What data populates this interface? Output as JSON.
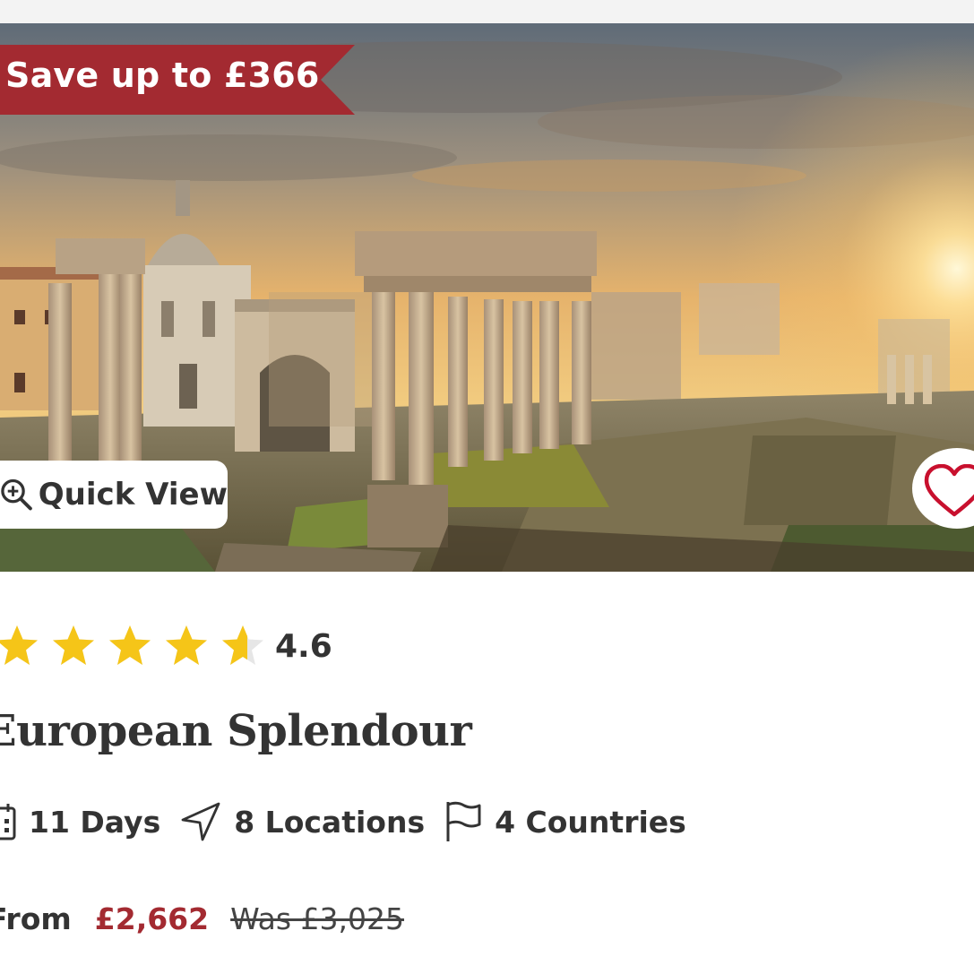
{
  "card": {
    "badge": {
      "label": "Save up to £366",
      "color": "#a32a31"
    },
    "image": {
      "subject": "Roman Forum ruins at sunset"
    },
    "quick_view": {
      "label": "Quick View",
      "icon": "zoom-in-icon"
    },
    "favorite": {
      "icon": "heart-outline-icon",
      "color": "#c8102e"
    },
    "rating": {
      "value": "4.6",
      "stars_filled": 4.6,
      "stars_total": 5,
      "star_color": "#f5c518"
    },
    "title": "European Splendour",
    "meta": {
      "days": {
        "label": "11 Days",
        "icon": "calendar-icon"
      },
      "locations": {
        "label": "8 Locations",
        "icon": "navigation-arrow-icon"
      },
      "countries": {
        "label": "4 Countries",
        "icon": "flag-icon"
      }
    },
    "price": {
      "from_label": "From",
      "current": "£2,662",
      "was": "Was £3,025",
      "current_color": "#a32a31"
    }
  }
}
